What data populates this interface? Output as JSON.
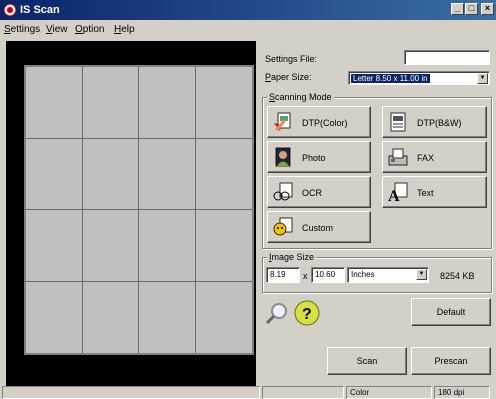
{
  "window": {
    "title": "IS Scan"
  },
  "menu": [
    "Settings",
    "View",
    "Option",
    "Help"
  ],
  "settings_file": {
    "label": "Settings File:",
    "value": ""
  },
  "paper_size": {
    "label": "Paper Size:",
    "value": "Letter 8.50 x 11.00 in"
  },
  "scanning_mode": {
    "title": "Scanning Mode",
    "buttons": [
      "DTP(Color)",
      "DTP(B&W)",
      "Photo",
      "FAX",
      "OCR",
      "Text",
      "Custom"
    ]
  },
  "image_size": {
    "title": "Image Size",
    "width": "8.19",
    "times": "x",
    "height": "10.60",
    "unit": "Inches",
    "file_size": "8254 KB"
  },
  "buttons": {
    "default": "Default",
    "scan": "Scan",
    "prescan": "Prescan"
  },
  "statusbar": {
    "mode": "Color",
    "resolution": "180 dpi"
  },
  "icons": [
    "magnifier-icon",
    "help-icon",
    "scanner-app-icon"
  ]
}
